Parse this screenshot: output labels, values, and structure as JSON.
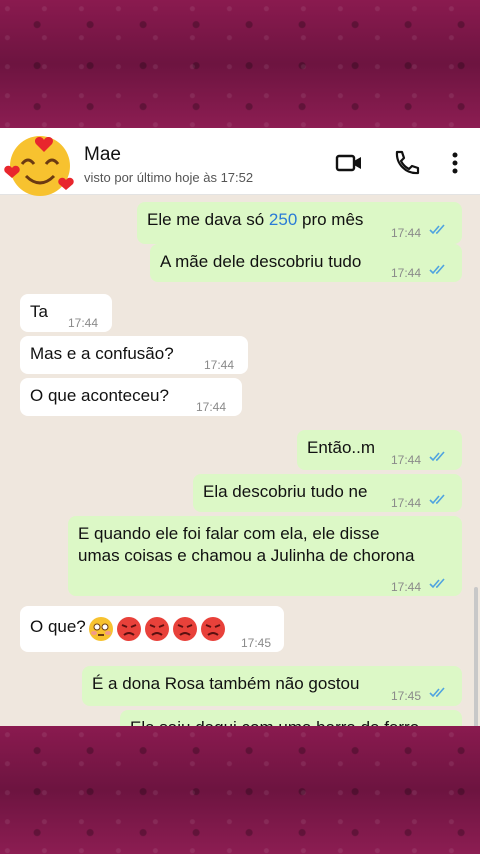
{
  "header": {
    "contact_name": "Mae",
    "last_seen": "visto por último hoje às 17:52",
    "icons": [
      "video-call-icon",
      "voice-call-icon",
      "more-options-icon"
    ]
  },
  "colors": {
    "outgoing_bubble": "#dcf8c6",
    "incoming_bubble": "#ffffff",
    "chat_background": "#efe7de",
    "read_ticks": "#4fa3e0",
    "background_band": "#7a1746"
  },
  "messages": [
    {
      "direction": "out",
      "text_before": "Ele me dava só ",
      "highlight": "250",
      "text_after": " pro mês",
      "time": "17:44"
    },
    {
      "direction": "out",
      "text": "A mãe dele descobriu tudo",
      "time": "17:44"
    },
    {
      "direction": "in",
      "text": "Ta",
      "time": "17:44"
    },
    {
      "direction": "in",
      "text": "Mas e a confusão?",
      "time": "17:44"
    },
    {
      "direction": "in",
      "text": "O que aconteceu?",
      "time": "17:44"
    },
    {
      "direction": "out",
      "text": "Então..m",
      "time": "17:44"
    },
    {
      "direction": "out",
      "text": "Ela descobriu tudo ne",
      "time": "17:44"
    },
    {
      "direction": "out",
      "line1": "E quando ele foi falar com ela, ele disse",
      "line2": "umas coisas e chamou a Julinha de chorona",
      "time": "17:44"
    },
    {
      "direction": "in",
      "text": "O que?",
      "emojis": [
        "flushed-face-emoji",
        "angry-face-emoji",
        "angry-face-emoji",
        "angry-face-emoji",
        "angry-face-emoji"
      ],
      "time": "17:45"
    },
    {
      "direction": "out",
      "text": "É a dona Rosa também não gostou",
      "time": "17:45"
    },
    {
      "direction": "out",
      "text": "Ela saiu daqui com uma barra de ferro",
      "partial": true
    }
  ]
}
